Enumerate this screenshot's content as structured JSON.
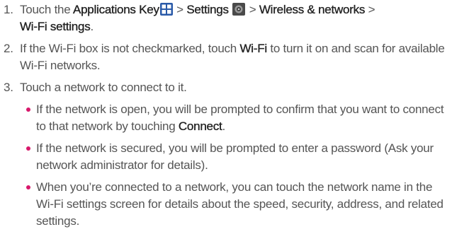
{
  "steps": [
    {
      "number": "1.",
      "parts": {
        "t1": "Touch the ",
        "b1": "Applications Key",
        "t2": " > ",
        "b2": "Settings",
        "t3": " > ",
        "b3": "Wireless & networks",
        "t4": " > ",
        "b4": "Wi-Fi settings",
        "t5": "."
      },
      "icons": [
        "applications-key-icon",
        "settings-icon"
      ]
    },
    {
      "number": "2.",
      "parts": {
        "t1": "If the Wi-Fi box is not checkmarked, touch ",
        "b1": "Wi-Fi",
        "t2": " to turn it on and scan for available Wi-Fi networks."
      }
    },
    {
      "number": "3.",
      "parts": {
        "t1": "Touch a network to connect to it."
      },
      "bullets": [
        {
          "t1": "If the network is open, you will be prompted to confirm that you want to connect to that network by touching ",
          "b1": "Connect",
          "t2": "."
        },
        {
          "t1": "If the network is secured, you will be prompted to enter a password (Ask your network administrator for details)."
        },
        {
          "t1": "When you’re connected to a network, you can touch the network name in the Wi-Fi settings screen for details about the speed, security, address, and related settings."
        }
      ]
    }
  ],
  "colors": {
    "text": "#555555",
    "bold_text": "#222222",
    "bullet": "#d8186b",
    "apps_icon": "#2a5aa8",
    "settings_icon": "#4a4a4a"
  }
}
